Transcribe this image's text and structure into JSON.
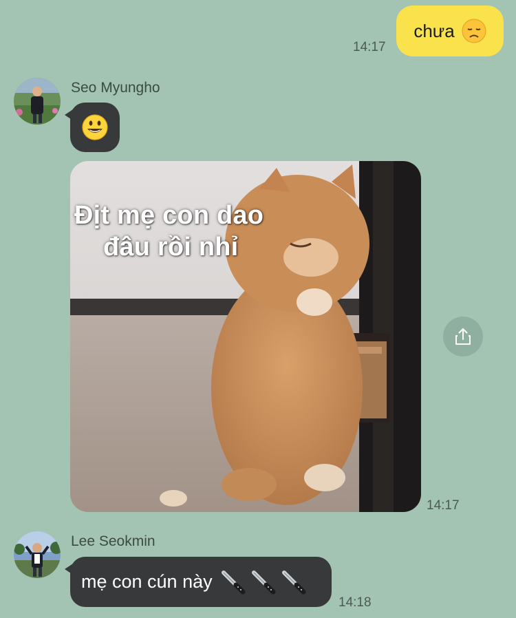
{
  "messages": {
    "out_1": {
      "text": "chưa",
      "emoji": "sad-face-emoji",
      "time": "14:17"
    },
    "in_1": {
      "sender": "Seo Myungho",
      "emoji": "smiley-emoji"
    },
    "in_2": {
      "image_caption_line1": "Địt mẹ con dao",
      "image_caption_line2": "đâu rồi nhỉ",
      "time": "14:17"
    },
    "in_3": {
      "sender": "Lee Seokmin",
      "text": "mẹ con cún này",
      "emoji": "knife-emoji",
      "time": "14:18"
    }
  },
  "colors": {
    "background": "#a3c4b3",
    "outgoing_bubble": "#f9e24c",
    "incoming_bubble": "#37393a"
  }
}
